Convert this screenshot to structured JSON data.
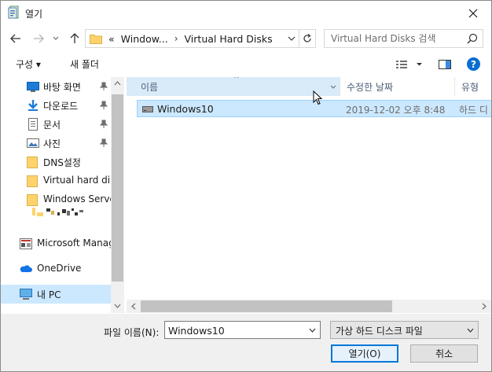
{
  "window": {
    "title": "열기",
    "title_icon": "open-file-dialog-icon",
    "close_icon": "close-icon"
  },
  "nav": {
    "back_icon": "arrow-left-icon",
    "forward_icon": "arrow-right-icon",
    "recent_icon": "chevron-down-icon",
    "up_icon": "arrow-up-icon"
  },
  "address": {
    "overflow": "«",
    "crumbs": [
      "Window...",
      "Virtual Hard Disks"
    ],
    "separator": "›",
    "refresh_icon": "refresh-icon"
  },
  "search": {
    "placeholder": "Virtual Hard Disks 검색",
    "icon": "search-icon"
  },
  "toolbar": {
    "organize_label": "구성 ▾",
    "new_folder_label": "새 폴더",
    "view_icon": "view-options-icon",
    "preview_icon": "preview-pane-icon",
    "help_icon": "help-icon",
    "help_label": "?"
  },
  "sidebar": {
    "items": [
      {
        "label": "바탕 화면",
        "icon": "desktop-icon",
        "pinned": true
      },
      {
        "label": "다운로드",
        "icon": "download-icon",
        "pinned": true
      },
      {
        "label": "문서",
        "icon": "document-icon",
        "pinned": true
      },
      {
        "label": "사진",
        "icon": "pictures-icon",
        "pinned": true
      },
      {
        "label": "DNS설정",
        "icon": "folder-icon",
        "pinned": false
      },
      {
        "label": "Virtual hard disk",
        "icon": "folder-icon",
        "pinned": false
      },
      {
        "label": "Windows Server",
        "icon": "folder-icon",
        "pinned": false
      },
      {
        "label": "Microsoft Manage",
        "icon": "microsoft-management-icon",
        "pinned": false
      },
      {
        "label": "OneDrive",
        "icon": "cloud-icon",
        "pinned": false
      },
      {
        "label": "내 PC",
        "icon": "computer-icon",
        "pinned": false,
        "selected": true
      }
    ]
  },
  "columns": {
    "name": "이름",
    "date": "수정한 날짜",
    "type": "유형",
    "sort_indicator": "^"
  },
  "files": [
    {
      "name": "Windows10",
      "date": "2019-12-02 오후 8:48",
      "type": "하드 디",
      "icon": "hard-disk-icon"
    }
  ],
  "bottom": {
    "filename_label": "파일 이름(N):",
    "filename_value": "Windows10",
    "filetype_value": "가상 하드 디스크 파일",
    "open_label": "열기(O)",
    "cancel_label": "취소"
  }
}
